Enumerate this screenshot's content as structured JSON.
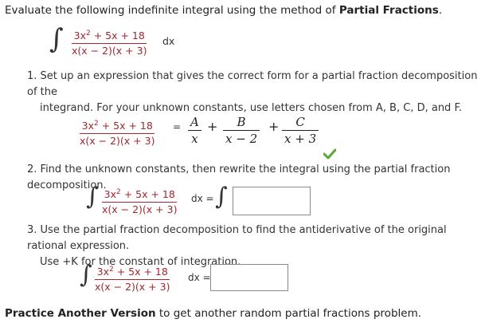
{
  "intro": {
    "text": "Evaluate the following indefinite integral using the method of ",
    "bold": "Partial Fractions",
    "end": "."
  },
  "integrand": {
    "numerator": "3x² + 5x + 18",
    "denominator": "x(x − 2)(x + 3)",
    "dx": "dx",
    "dx_eq": "dx ="
  },
  "step1": {
    "line1": "1. Set up an expression that gives the correct form for a partial fraction decomposition of the",
    "line2": "integrand. For your unknown constants, use letters chosen from A, B, C, D, and F.",
    "eq": "=",
    "plus": "+",
    "terms": [
      {
        "num": "A",
        "den": "x"
      },
      {
        "num": "B",
        "den": "x − 2"
      },
      {
        "num": "C",
        "den": "x + 3"
      }
    ],
    "status": "correct"
  },
  "step2": {
    "line": "2. Find the unknown constants, then rewrite the integral using the partial fraction decomposition.",
    "answer": ""
  },
  "step3": {
    "line1": "3. Use the partial fraction decomposition to find the antiderivative of the original rational expression.",
    "line2": "Use +K for the constant of integration.",
    "answer": ""
  },
  "practice": {
    "bold": "Practice Another Version",
    "rest": " to get another random partial fractions problem."
  },
  "colors": {
    "accent": "#a0282f",
    "check": "#5aa832"
  }
}
